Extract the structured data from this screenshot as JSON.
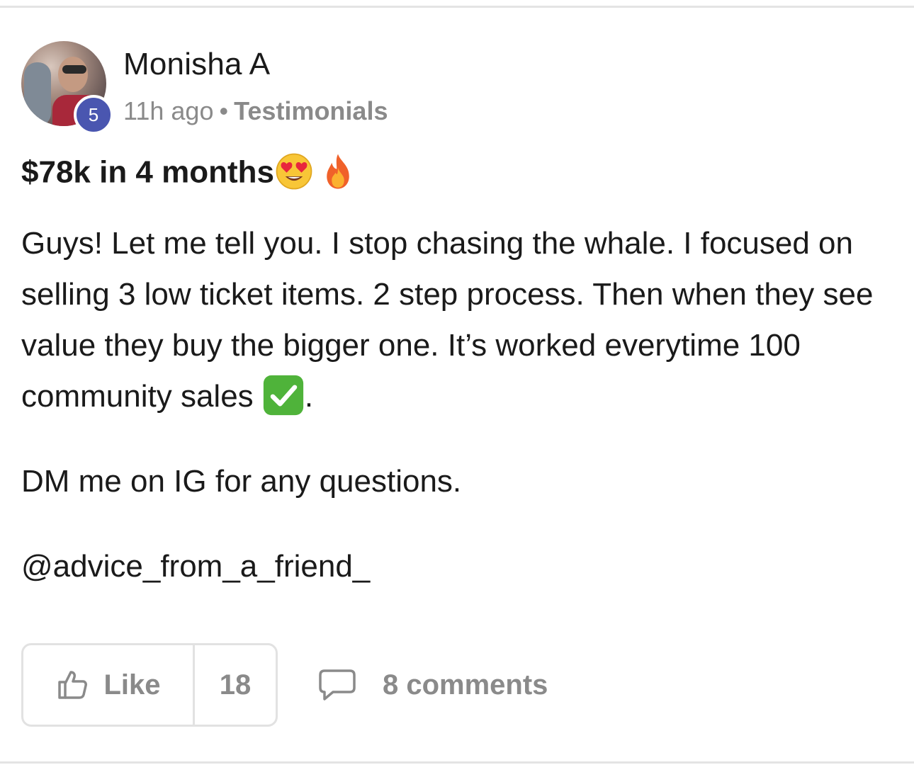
{
  "post": {
    "author": {
      "name": "Monisha A",
      "level": "5"
    },
    "meta": {
      "time": "11h ago",
      "separator": "•",
      "category": "Testimonials"
    },
    "title": "$78k in 4 months",
    "title_emojis": [
      "heart-eyes-emoji",
      "fire-emoji"
    ],
    "body": {
      "paragraph1_text": "Guys! Let me tell you. I stop chasing the whale. I focused on selling 3 low ticket items. 2 step process. Then when they see value they buy the bigger one. It’s worked everytime 100 community sales ",
      "paragraph1_end": ".",
      "paragraph2": "DM me on IG for any questions.",
      "paragraph3": "@advice_from_a_friend_"
    },
    "actions": {
      "like_label": "Like",
      "like_count": "18",
      "comments_label": "8 comments"
    }
  },
  "colors": {
    "badge": "#4a56b0",
    "muted_text": "#8a8a8a",
    "primary_text": "#1a1a1a",
    "border": "#e2e2e2",
    "check_green": "#4fb33a"
  }
}
